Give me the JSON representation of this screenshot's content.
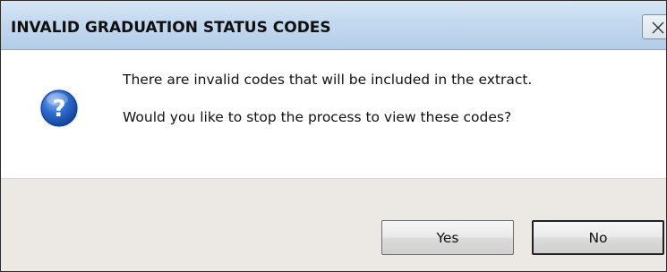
{
  "dialog": {
    "title": "INVALID GRADUATION STATUS CODES",
    "close_icon": "close-icon",
    "icon": "question-icon",
    "message_line1": "There are invalid codes that will be included in the extract.",
    "message_line2": "Would you like to stop the process to view these codes?",
    "buttons": {
      "yes_label": "Yes",
      "no_label": "No"
    },
    "default_button": "No"
  },
  "colors": {
    "titlebar": "#c3d9ef",
    "footer": "#ece9e4",
    "icon_blue": "#1d55b8"
  }
}
